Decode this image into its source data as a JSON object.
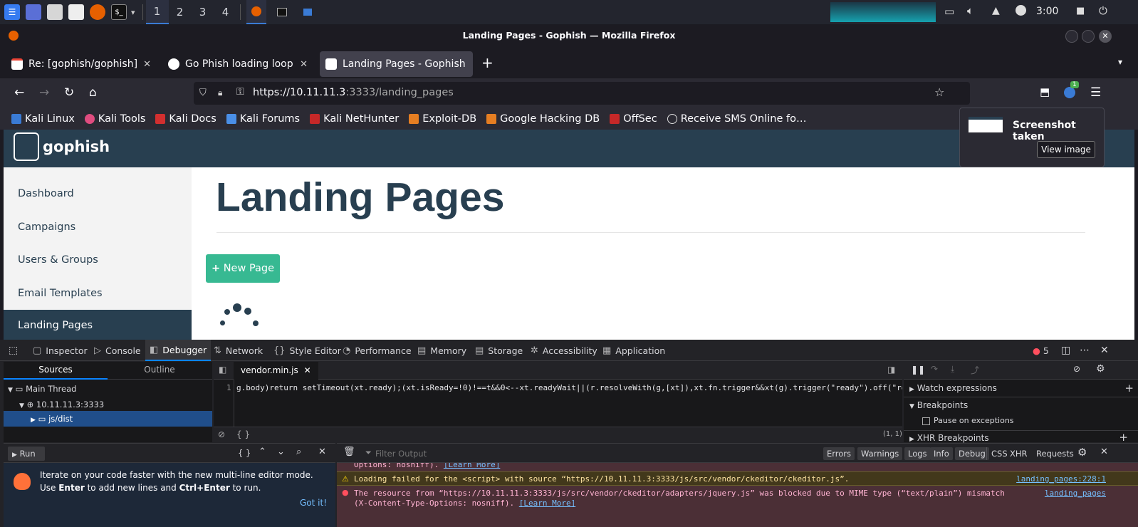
{
  "taskbar": {
    "workspaces": [
      "1",
      "2",
      "3",
      "4"
    ],
    "clock": "3:00"
  },
  "window": {
    "title": "Landing Pages - Gophish — Mozilla Firefox"
  },
  "tabs": [
    {
      "label": "Re: [gophish/gophish] Go",
      "favicon": "gmail-icon"
    },
    {
      "label": "Go Phish loading loop at l",
      "favicon": "github-icon"
    },
    {
      "label": "Landing Pages - Gophish",
      "favicon": "gophish-icon"
    }
  ],
  "url": {
    "host": "https://10.11.11.3",
    "rest": ":3333/landing_pages"
  },
  "bookmarks": [
    "Kali Linux",
    "Kali Tools",
    "Kali Docs",
    "Kali Forums",
    "Kali NetHunter",
    "Exploit-DB",
    "Google Hacking DB",
    "OffSec",
    "Receive SMS Online fo…"
  ],
  "extension_badge": "1",
  "notification": {
    "title": "Screenshot taken",
    "button": "View image"
  },
  "gophish": {
    "brand": "gophish",
    "heading": "Landing Pages",
    "new_button": "New Page",
    "sidebar": [
      "Dashboard",
      "Campaigns",
      "Users & Groups",
      "Email Templates",
      "Landing Pages"
    ]
  },
  "devtools": {
    "tools": [
      "Inspector",
      "Console",
      "Debugger",
      "Network",
      "Style Editor",
      "Performance",
      "Memory",
      "Storage",
      "Accessibility",
      "Application"
    ],
    "error_count": "5",
    "sources_tab": "Sources",
    "outline_tab": "Outline",
    "tree": [
      "Main Thread",
      "10.11.11.3:3333",
      "js/dist"
    ],
    "file_tab": "vendor.min.js",
    "line_number": "1",
    "code": "g.body)return setTimeout(xt.ready);(xt.isReady=!0)!==t&&0<--xt.readyWait||(r.resolveWith(g,[xt]),xt.fn.trigger&&xt(g).trigger(\"ready\").off(\"read",
    "braces": "{ }",
    "cursor_pos": "(1, 1)",
    "right_panel": {
      "watch": "Watch expressions",
      "breakpoints": "Breakpoints",
      "pause": "Pause on exceptions",
      "xhr": "XHR Breakpoints"
    },
    "console": {
      "run": "Run",
      "filter_placeholder": "Filter Output",
      "filters": [
        "Errors",
        "Warnings",
        "Logs",
        "Info",
        "Debug"
      ],
      "filters2": [
        "CSS",
        "XHR",
        "Requests"
      ],
      "tip_a": "Iterate on your code faster with the new multi-line editor mode. Use ",
      "tip_enter": "Enter",
      "tip_b": " to add new lines and ",
      "tip_ctrl": "Ctrl+Enter",
      "tip_c": " to run.",
      "got_it": "Got it!",
      "msg0": "Options: nosniff).",
      "learn_more": "[Learn More]",
      "msg1": "Loading failed for the <script> with source “https://10.11.11.3:3333/js/src/vendor/ckeditor/ckeditor.js”.",
      "msg1_src": "landing_pages:228:1",
      "msg2": "The resource from “https://10.11.11.3:3333/js/src/vendor/ckeditor/adapters/jquery.js” was blocked due to MIME type (“text/plain”) mismatch (X-Content-Type-Options: nosniff).",
      "msg2_src": "landing_pages"
    }
  }
}
